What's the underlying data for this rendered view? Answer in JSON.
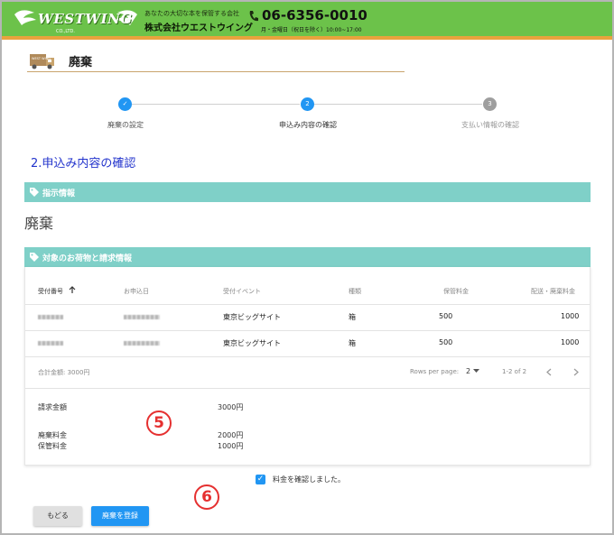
{
  "header": {
    "logo_text": "WESTWING",
    "logo_sub": "CO.,LTD.",
    "tagline": "あなたの大切な本を保管する会社",
    "company": "株式会社ウエストウイング",
    "phone": "06-6356-0010",
    "hours": "月・金曜日（祝日を除く）10:00~17:00",
    "colors": {
      "header_bg": "#6cc24a",
      "header_accent": "#e8a33d"
    }
  },
  "page": {
    "title": "廃棄",
    "truck_label": "WEST WING"
  },
  "stepper": {
    "steps": [
      {
        "number": "✓",
        "label": "廃棄の設定",
        "state": "done"
      },
      {
        "number": "2",
        "label": "申込み内容の確認",
        "state": "active"
      },
      {
        "number": "3",
        "label": "支払い情報の確認",
        "state": "pending"
      }
    ]
  },
  "section_heading": "2.申込み内容の確認",
  "instruction": {
    "bar_label": "指示情報",
    "value": "廃棄"
  },
  "items": {
    "bar_label": "対象のお荷物と請求情報",
    "columns": [
      "受付番号",
      "お申込日",
      "受付イベント",
      "種類",
      "保管料金",
      "配送・廃棄料金"
    ],
    "sort_icon": "arrow-up-icon",
    "rows": [
      {
        "event": "東京ビッグサイト",
        "type": "箱",
        "storage_fee": "500",
        "disposal_fee": "1000"
      },
      {
        "event": "東京ビッグサイト",
        "type": "箱",
        "storage_fee": "500",
        "disposal_fee": "1000"
      }
    ],
    "total_label": "合計金額: 3000円",
    "rows_per_page_label": "Rows per page:",
    "rows_per_page_value": "2",
    "range_label": "1-2 of 2",
    "summary": {
      "billing_label": "請求金額",
      "billing_value": "3000円",
      "disposal_label": "廃棄料金",
      "disposal_value": "2000円",
      "storage_label": "保管料金",
      "storage_value": "1000円"
    }
  },
  "annotations": {
    "five": "5",
    "six": "6",
    "color": "#e53030"
  },
  "confirm_label": "料金を確認しました。",
  "buttons": {
    "back": "もどる",
    "register": "廃棄を登録"
  },
  "colors": {
    "accent": "#2196f3",
    "bar": "#7fd0c8",
    "heading": "#2233cc"
  }
}
